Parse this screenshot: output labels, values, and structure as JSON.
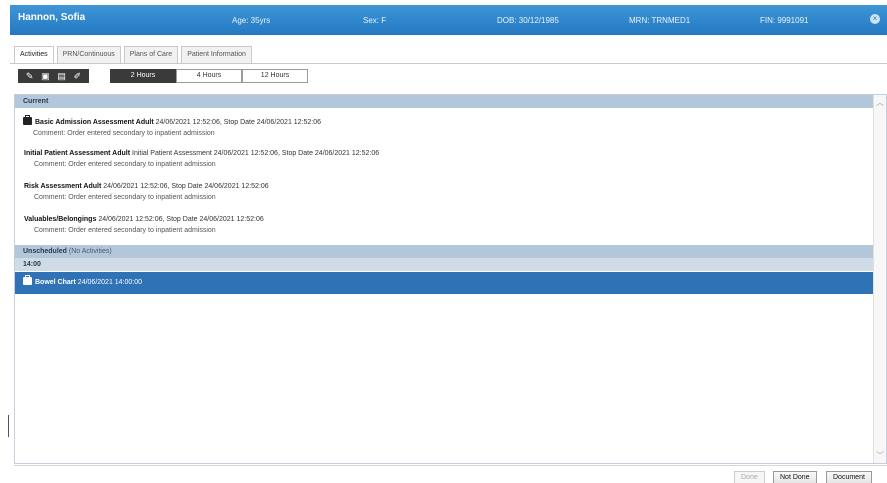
{
  "banner": {
    "patient_name": "Hannon, Sofia",
    "age": "Age: 35yrs",
    "sex": "Sex: F",
    "dob": "DOB: 30/12/1985",
    "mrn": "MRN: TRNMED1",
    "fin": "FIN: 9991091",
    "close_glyph": "×"
  },
  "tabs": [
    "Activities",
    "PRN/Continuous",
    "Plans of Care",
    "Patient Information"
  ],
  "toolbar": {
    "icons": [
      "pencil-icon",
      "bag-icon",
      "clipboard-icon",
      "edit-icon"
    ],
    "glyphs": [
      "✎",
      "▣",
      "▤",
      "✐"
    ]
  },
  "time_buttons": [
    "2 Hours",
    "4 Hours",
    "12 Hours"
  ],
  "sections": {
    "current": "Current",
    "unscheduled": "Unscheduled",
    "unscheduled_note": "(No Activities)",
    "time_group": "14:00"
  },
  "activities": [
    {
      "name": "Basic Admission Assessment Adult",
      "detail": "24/06/2021 12:52:06, Stop Date 24/06/2021 12:52:06",
      "comment": "Comment: Order entered secondary to inpatient admission"
    },
    {
      "name": "Initial Patient Assessment Adult",
      "detail": "Initial Patient Assessment 24/06/2021 12:52:06, Stop Date 24/06/2021 12:52:06",
      "comment": "Comment: Order entered secondary to inpatient admission"
    },
    {
      "name": "Risk Assessment Adult",
      "detail": "24/06/2021 12:52:06, Stop Date 24/06/2021 12:52:06",
      "comment": "Comment: Order entered secondary to inpatient admission"
    },
    {
      "name": "Valuables/Belongings",
      "detail": "24/06/2021 12:52:06, Stop Date 24/06/2021 12:52:06",
      "comment": "Comment: Order entered secondary to inpatient admission"
    }
  ],
  "selected_activity": {
    "name": "Bowel Chart",
    "detail": "24/06/2021 14:00:00"
  },
  "footer": {
    "done": "Done",
    "not_done": "Not Done",
    "document": "Document"
  },
  "colors": {
    "banner": "#2479c2",
    "selection": "#2f73b6",
    "section": "#b3c7db"
  }
}
